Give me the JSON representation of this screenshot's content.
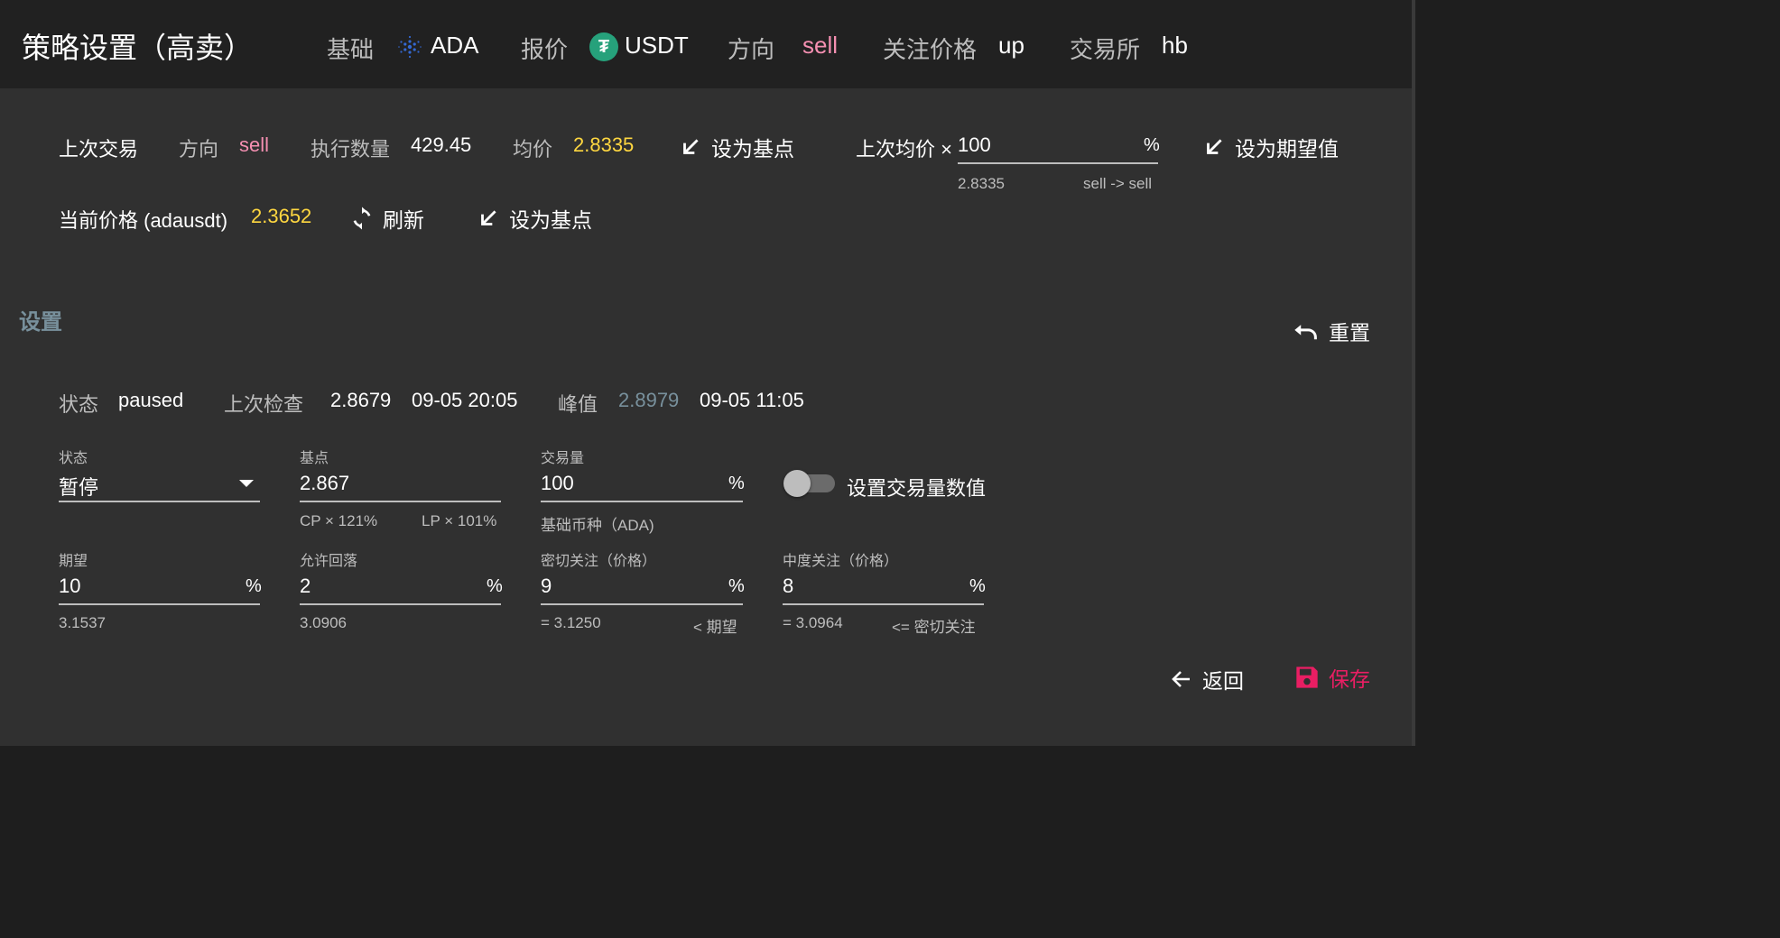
{
  "header": {
    "title": "策略设置（高卖）",
    "base_label": "基础",
    "base_coin": "ADA",
    "quote_label": "报价",
    "quote_coin": "USDT",
    "direction_label": "方向",
    "direction_value": "sell",
    "watch_label": "关注价格",
    "watch_value": "up",
    "exchange_label": "交易所",
    "exchange_value": "hb"
  },
  "last_trade": {
    "label": "上次交易",
    "direction_label": "方向",
    "direction_value": "sell",
    "qty_label": "执行数量",
    "qty_value": "429.45",
    "avg_label": "均价",
    "avg_value": "2.8335",
    "set_base_button": "设为基点",
    "avg_multiplier_label": "上次均价 ×",
    "avg_multiplier_value": "100",
    "avg_multiplier_suffix": "%",
    "avg_multiplier_hint_left": "2.8335",
    "avg_multiplier_hint_right": "sell -> sell",
    "set_expect_button": "设为期望值"
  },
  "current_price": {
    "label": "当前价格 (adausdt)",
    "value": "2.3652",
    "refresh_button": "刷新",
    "set_base_button": "设为基点"
  },
  "settings": {
    "title": "设置",
    "reset_button": "重置",
    "status_label": "状态",
    "status_value": "paused",
    "last_check_label": "上次检查",
    "last_check_price": "2.8679",
    "last_check_time": "09-05 20:05",
    "peak_label": "峰值",
    "peak_value": "2.8979",
    "peak_time": "09-05 11:05"
  },
  "form": {
    "state": {
      "label": "状态",
      "value": "暂停"
    },
    "base": {
      "label": "基点",
      "value": "2.867",
      "hint_left": "CP × 121%",
      "hint_right": "LP × 101%"
    },
    "volume": {
      "label": "交易量",
      "value": "100",
      "suffix": "%",
      "hint": "基础币种（ADA)"
    },
    "volume_toggle": {
      "label": "设置交易量数值",
      "checked": false
    },
    "expect": {
      "label": "期望",
      "value": "10",
      "suffix": "%",
      "hint": "3.1537"
    },
    "drawdown": {
      "label": "允许回落",
      "value": "2",
      "suffix": "%",
      "hint": "3.0906"
    },
    "close_watch": {
      "label": "密切关注（价格）",
      "value": "9",
      "suffix": "%",
      "hint_left": "= 3.1250",
      "hint_right": "< 期望"
    },
    "mid_watch": {
      "label": "中度关注（价格）",
      "value": "8",
      "suffix": "%",
      "hint_left": "= 3.0964",
      "hint_right": "<= 密切关注"
    }
  },
  "footer": {
    "back_button": "返回",
    "save_button": "保存"
  },
  "colors": {
    "accent_yellow": "#ffd740",
    "accent_pink": "#f48fb1",
    "save_red": "#e91e63",
    "muted_bluegray": "#78909c",
    "usdt_green": "#26a17b",
    "ada_blue": "#3468d1"
  },
  "icons": {
    "ada": "ada-icon",
    "usdt": "usdt-icon",
    "set_base": "arrow-down-left-icon",
    "refresh": "refresh-icon",
    "reset": "undo-icon",
    "back": "arrow-left-icon",
    "save": "floppy-disk-icon",
    "dropdown": "caret-down-icon"
  }
}
